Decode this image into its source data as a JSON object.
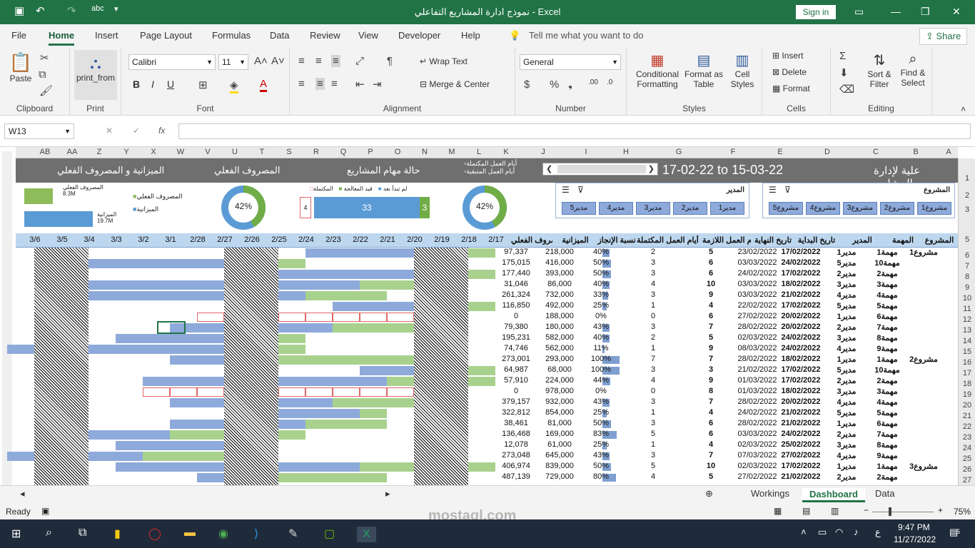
{
  "window": {
    "title": "نموذج ادارة المشاريع التفاعلي  -  Excel",
    "signin": "Sign in"
  },
  "menu": {
    "items": [
      "File",
      "Home",
      "Insert",
      "Page Layout",
      "Formulas",
      "Data",
      "Review",
      "View",
      "Developer",
      "Help"
    ],
    "tell": "Tell me what you want to do",
    "share": "Share"
  },
  "ribbon": {
    "clipboard": {
      "label": "Clipboard",
      "paste": "Paste"
    },
    "print": {
      "label": "Print",
      "btn": "print_from"
    },
    "font": {
      "label": "Font",
      "name": "Calibri",
      "size": "11"
    },
    "alignment": {
      "label": "Alignment",
      "wrap": "Wrap Text",
      "merge": "Merge & Center"
    },
    "number": {
      "label": "Number",
      "format": "General"
    },
    "styles": {
      "label": "Styles",
      "conditional": "Conditional Formatting",
      "format_table": "Format as Table",
      "cell_styles": "Cell Styles"
    },
    "cells": {
      "label": "Cells",
      "insert": "Insert",
      "delete": "Delete",
      "format": "Format"
    },
    "editing": {
      "label": "Editing",
      "sort": "Sort & Filter",
      "find": "Find & Select"
    }
  },
  "formula": {
    "namebox": "W13",
    "fx": "fx"
  },
  "columns": [
    "AB",
    "AA",
    "Z",
    "Y",
    "X",
    "W",
    "V",
    "U",
    "T",
    "S",
    "R",
    "Q",
    "P",
    "O",
    "N",
    "M",
    "L",
    "K",
    "J",
    "I",
    "H",
    "G",
    "F",
    "E",
    "D",
    "C",
    "B",
    "A"
  ],
  "rows": [
    "1",
    "2",
    "3",
    "5",
    "6",
    "7",
    "8",
    "9",
    "10",
    "11",
    "12",
    "13",
    "14",
    "15",
    "16",
    "17",
    "18",
    "19",
    "20",
    "21",
    "22",
    "23",
    "24",
    "25",
    "26",
    "27"
  ],
  "dashboard": {
    "title": "علية لإدارة المشاريع",
    "date_range": "17-02-22 to 15-03-22",
    "legend_completed": "أيام العمل المكتملة",
    "legend_remaining": "أيام العمل المتبقية",
    "section_status": "حالة مهام المشاريع",
    "section_actual": "المصروف الفعلي",
    "section_budget": "الميزانية و المصروف الفعلي",
    "status_legend": [
      "لم تبدأ بعد",
      "قيد المعالجة",
      "المكتملة"
    ],
    "status_values": {
      "not_started": "4",
      "in_progress": "33",
      "completed": "3"
    },
    "donut1": "42%",
    "donut2": "42%",
    "bar_actual_label": "المصروف الفعلي",
    "bar_actual_value": "8.3M",
    "bar_budget_label": "الميزانية",
    "bar_budget_value": "19.7M",
    "legend_actual": "المصروف الفعلي",
    "legend_budget": "الميزانية",
    "slicer_manager": {
      "title": "المدير",
      "items": [
        "مدير1",
        "مدير2",
        "مدير3",
        "مدير4",
        "مدير5"
      ]
    },
    "slicer_project": {
      "title": "المشروع",
      "items": [
        "مشروع1",
        "مشروع2",
        "مشروع3",
        "مشروع4",
        "مشروع5"
      ]
    }
  },
  "table": {
    "headers": [
      "المصروف الفعلي",
      "الميزانية",
      "نسبة الإنجاز",
      "عدد أيام العمل المكتملة",
      "أيام العمل اللازمة",
      "تاريخ النهاية",
      "تاريخ البداية",
      "المدير",
      "المهمة",
      "المشروع"
    ],
    "dates": [
      "3/6",
      "3/5",
      "3/4",
      "3/3",
      "3/2",
      "3/1",
      "2/28",
      "2/27",
      "2/26",
      "2/25",
      "2/24",
      "2/23",
      "2/22",
      "2/21",
      "2/20",
      "2/19",
      "2/18",
      "2/17"
    ],
    "rows": [
      [
        "97,337",
        "218,000",
        "40%",
        "2",
        "5",
        "23/02/2022",
        "17/02/2022",
        "مدير1",
        "مهمة1",
        "مشروع1"
      ],
      [
        "175,015",
        "416,000",
        "50%",
        "3",
        "6",
        "03/03/2022",
        "24/02/2022",
        "مدير5",
        "مهمة10",
        ""
      ],
      [
        "177,440",
        "393,000",
        "50%",
        "3",
        "6",
        "24/02/2022",
        "17/02/2022",
        "مدير2",
        "مهمة2",
        ""
      ],
      [
        "31,046",
        "86,000",
        "40%",
        "4",
        "10",
        "03/03/2022",
        "18/02/2022",
        "مدير3",
        "مهمة3",
        ""
      ],
      [
        "261,324",
        "732,000",
        "33%",
        "3",
        "9",
        "03/03/2022",
        "21/02/2022",
        "مدير4",
        "مهمة4",
        ""
      ],
      [
        "116,850",
        "492,000",
        "25%",
        "1",
        "4",
        "22/02/2022",
        "17/02/2022",
        "مدير5",
        "مهمة5",
        ""
      ],
      [
        "0",
        "188,000",
        "0%",
        "0",
        "6",
        "27/02/2022",
        "20/02/2022",
        "مدير1",
        "مهمة6",
        ""
      ],
      [
        "79,380",
        "180,000",
        "43%",
        "3",
        "7",
        "28/02/2022",
        "20/02/2022",
        "مدير2",
        "مهمة7",
        ""
      ],
      [
        "195,231",
        "582,000",
        "40%",
        "2",
        "5",
        "02/03/2022",
        "24/02/2022",
        "مدير3",
        "مهمة8",
        ""
      ],
      [
        "74,746",
        "562,000",
        "11%",
        "1",
        "9",
        "08/03/2022",
        "24/02/2022",
        "مدير4",
        "مهمة9",
        ""
      ],
      [
        "273,001",
        "293,000",
        "100%",
        "7",
        "7",
        "28/02/2022",
        "18/02/2022",
        "مدير1",
        "مهمة1",
        "مشروع2"
      ],
      [
        "64,987",
        "68,000",
        "100%",
        "3",
        "3",
        "21/02/2022",
        "17/02/2022",
        "مدير5",
        "مهمة10",
        ""
      ],
      [
        "57,910",
        "224,000",
        "44%",
        "4",
        "9",
        "01/03/2022",
        "17/02/2022",
        "مدير2",
        "مهمة2",
        ""
      ],
      [
        "0",
        "978,000",
        "0%",
        "0",
        "8",
        "01/03/2022",
        "18/02/2022",
        "مدير3",
        "مهمة3",
        ""
      ],
      [
        "379,157",
        "932,000",
        "43%",
        "3",
        "7",
        "28/02/2022",
        "20/02/2022",
        "مدير4",
        "مهمة4",
        ""
      ],
      [
        "322,812",
        "854,000",
        "25%",
        "1",
        "4",
        "24/02/2022",
        "21/02/2022",
        "مدير5",
        "مهمة5",
        ""
      ],
      [
        "38,461",
        "81,000",
        "50%",
        "3",
        "6",
        "28/02/2022",
        "21/02/2022",
        "مدير1",
        "مهمة6",
        ""
      ],
      [
        "136,468",
        "169,000",
        "83%",
        "5",
        "6",
        "03/03/2022",
        "24/02/2022",
        "مدير2",
        "مهمة7",
        ""
      ],
      [
        "12,078",
        "61,000",
        "25%",
        "1",
        "4",
        "02/03/2022",
        "25/02/2022",
        "مدير3",
        "مهمة8",
        ""
      ],
      [
        "273,048",
        "645,000",
        "43%",
        "3",
        "7",
        "07/03/2022",
        "27/02/2022",
        "مدير4",
        "مهمة9",
        ""
      ],
      [
        "406,974",
        "839,000",
        "50%",
        "5",
        "10",
        "02/03/2022",
        "17/02/2022",
        "مدير1",
        "مهمة1",
        "مشروع3"
      ],
      [
        "487,139",
        "729,000",
        "80%",
        "4",
        "5",
        "27/02/2022",
        "21/02/2022",
        "مدير2",
        "مهمة2",
        ""
      ]
    ]
  },
  "sheets": [
    "Workings",
    "Dashboard",
    "Data"
  ],
  "status": {
    "ready": "Ready",
    "zoom": "75%"
  },
  "taskbar": {
    "time": "9:47 PM",
    "date": "11/27/2022",
    "lang": "ع",
    "notif": "5"
  },
  "watermark": {
    "text": "mostaql.com"
  }
}
